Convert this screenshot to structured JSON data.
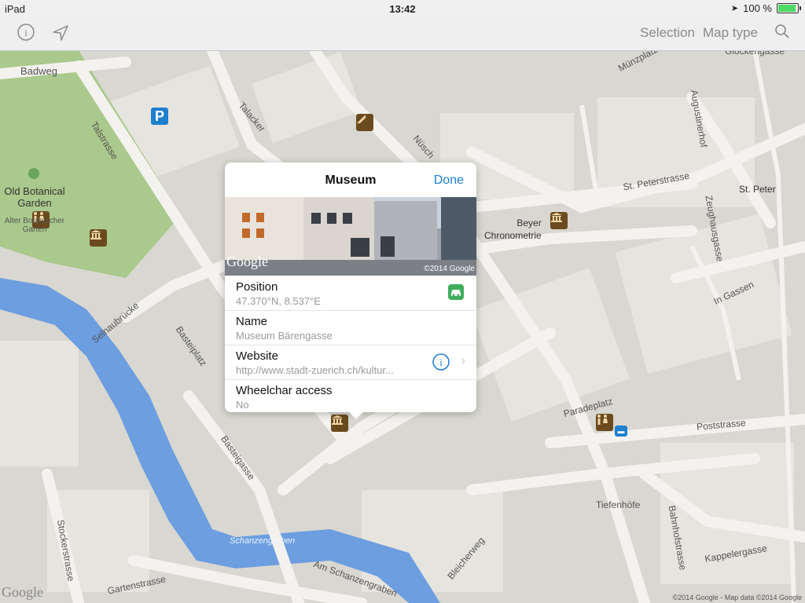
{
  "status_bar": {
    "device": "iPad",
    "time": "13:42",
    "battery": "100 %"
  },
  "toolbar": {
    "selection_label": "Selection",
    "map_type_label": "Map type"
  },
  "map": {
    "labels": {
      "badweg": "Badweg",
      "talstrasse": "Talstrasse",
      "talacker": "Talacker",
      "nuesch": "Nüsch",
      "old_botanical_garden": "Old Botanical Garden",
      "alter_botanischer_garten": "Alter Botanischer Garten",
      "selnaubruecke": "Selnaubrücke",
      "basteiplatz": "Basteiplatz",
      "bastei_gasse": "Basteigasse",
      "schanzengraben": "Schanzengraben",
      "am_schanzengraben": "Am Schanzengraben",
      "gartenstrasse": "Gartenstrasse",
      "stockerstrasse": "Stockerstrasse",
      "bleicherweg": "Bleicherweg",
      "muenzplatz": "Münzplatz",
      "glockengasse": "Glockengasse",
      "augustinerhof": "Augustinerhof",
      "st_peterstrasse": "St. Peterstrasse",
      "st_peter": "St. Peter",
      "beyer_chronometrie": "Beyer\nChronometrie",
      "zeughausgasse": "Zeughausgasse",
      "in_gassen": "In Gassen",
      "paradeplatz": "Paradeplatz",
      "poststrasse": "Poststrasse",
      "tiefenhoefe": "Tiefenhöfe",
      "bahnhofstrasse": "Bahnhofstrasse",
      "kappelergasse": "Kappelergasse",
      "google_logo": "Google",
      "copyright": "©2014 Google - Map data ©2014 Google"
    }
  },
  "popover": {
    "title": "Museum",
    "done_label": "Done",
    "photo_logo": "Google",
    "photo_copyright": "©2014 Google",
    "rows": [
      {
        "key": "Position",
        "value": "47.370°N, 8.537°E"
      },
      {
        "key": "Name",
        "value": "Museum Bärengasse"
      },
      {
        "key": "Website",
        "value": "http://www.stadt-zuerich.ch/kultur..."
      },
      {
        "key": "Wheelchar access",
        "value": "No"
      }
    ]
  },
  "colors": {
    "accent": "#1a7fd4",
    "water": "#6c9ee0",
    "park": "#a9c98a",
    "poi_brown": "#6b4a1e"
  }
}
